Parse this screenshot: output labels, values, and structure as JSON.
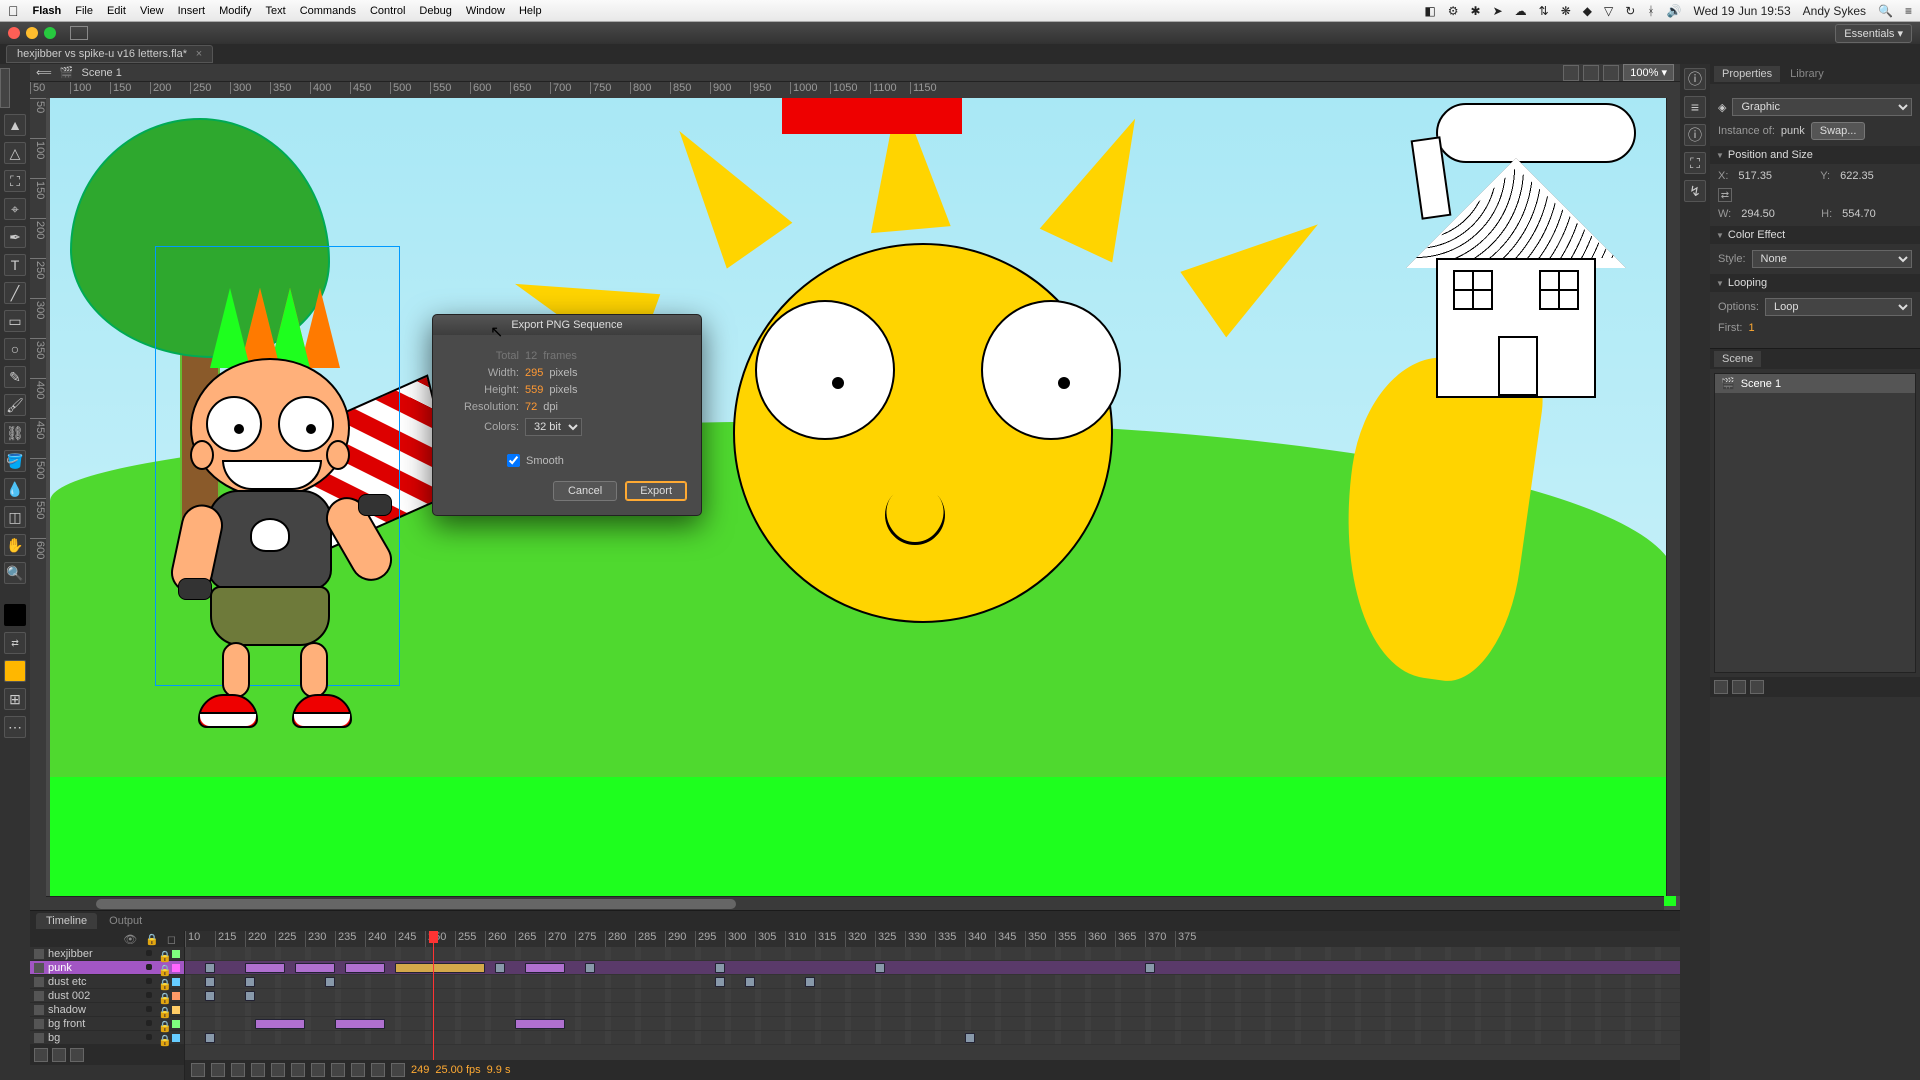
{
  "menubar": {
    "app": "Flash",
    "items": [
      "File",
      "Edit",
      "View",
      "Insert",
      "Modify",
      "Text",
      "Commands",
      "Control",
      "Debug",
      "Window",
      "Help"
    ],
    "clock": "Wed 19 Jun  19:53",
    "user": "Andy Sykes"
  },
  "chrome": {
    "workspace": "Essentials"
  },
  "document": {
    "tab": "hexjibber vs spike-u v16 letters.fla*",
    "scene": "Scene 1",
    "zoom": "100%"
  },
  "ruler_h": [
    "50",
    "100",
    "150",
    "200",
    "250",
    "300",
    "350",
    "400",
    "450",
    "500",
    "550",
    "600",
    "650",
    "700",
    "750",
    "800",
    "850",
    "900",
    "950",
    "1000",
    "1050",
    "1100",
    "1150"
  ],
  "ruler_v": [
    "50",
    "100",
    "150",
    "200",
    "250",
    "300",
    "350",
    "400",
    "450",
    "500",
    "550",
    "600"
  ],
  "dialog": {
    "title": "Export PNG Sequence",
    "total_label": "Total",
    "total_value": "12",
    "total_unit": "frames",
    "width_label": "Width:",
    "width_value": "295",
    "width_unit": "pixels",
    "height_label": "Height:",
    "height_value": "559",
    "height_unit": "pixels",
    "res_label": "Resolution:",
    "res_value": "72",
    "res_unit": "dpi",
    "colors_label": "Colors:",
    "colors_value": "32 bit",
    "smooth_label": "Smooth",
    "cancel": "Cancel",
    "export": "Export"
  },
  "timeline": {
    "tabs": [
      "Timeline",
      "Output"
    ],
    "frames": [
      "10",
      "215",
      "220",
      "225",
      "230",
      "235",
      "240",
      "245",
      "250",
      "255",
      "260",
      "265",
      "270",
      "275",
      "280",
      "285",
      "290",
      "295",
      "300",
      "305",
      "310",
      "315",
      "320",
      "325",
      "330",
      "335",
      "340",
      "345",
      "350",
      "355",
      "360",
      "365",
      "370",
      "375"
    ],
    "layers": [
      {
        "name": "hexjibber",
        "sel": false,
        "color": "#7fff7f"
      },
      {
        "name": "punk",
        "sel": true,
        "color": "#ff66ff"
      },
      {
        "name": "dust etc",
        "sel": false,
        "color": "#66ccff"
      },
      {
        "name": "dust 002",
        "sel": false,
        "color": "#ff9966"
      },
      {
        "name": "shadow",
        "sel": false,
        "color": "#ffcc66"
      },
      {
        "name": "bg front",
        "sel": false,
        "color": "#7fff7f"
      },
      {
        "name": "bg",
        "sel": false,
        "color": "#66ccff"
      }
    ],
    "status": {
      "frame": "249",
      "fps": "25.00 fps",
      "time": "9.9 s"
    }
  },
  "properties": {
    "tabs": [
      "Properties",
      "Library"
    ],
    "type": "Graphic",
    "instance_label": "Instance of:",
    "instance": "punk",
    "swap": "Swap...",
    "pos_size": "Position and Size",
    "x_label": "X:",
    "x": "517.35",
    "y_label": "Y:",
    "y": "622.35",
    "w_label": "W:",
    "w": "294.50",
    "h_label": "H:",
    "h": "554.70",
    "color_effect": "Color Effect",
    "style_label": "Style:",
    "style": "None",
    "looping": "Looping",
    "options_label": "Options:",
    "options": "Loop",
    "first_label": "First:",
    "first": "1"
  },
  "scene_panel": {
    "title": "Scene",
    "item": "Scene 1"
  }
}
